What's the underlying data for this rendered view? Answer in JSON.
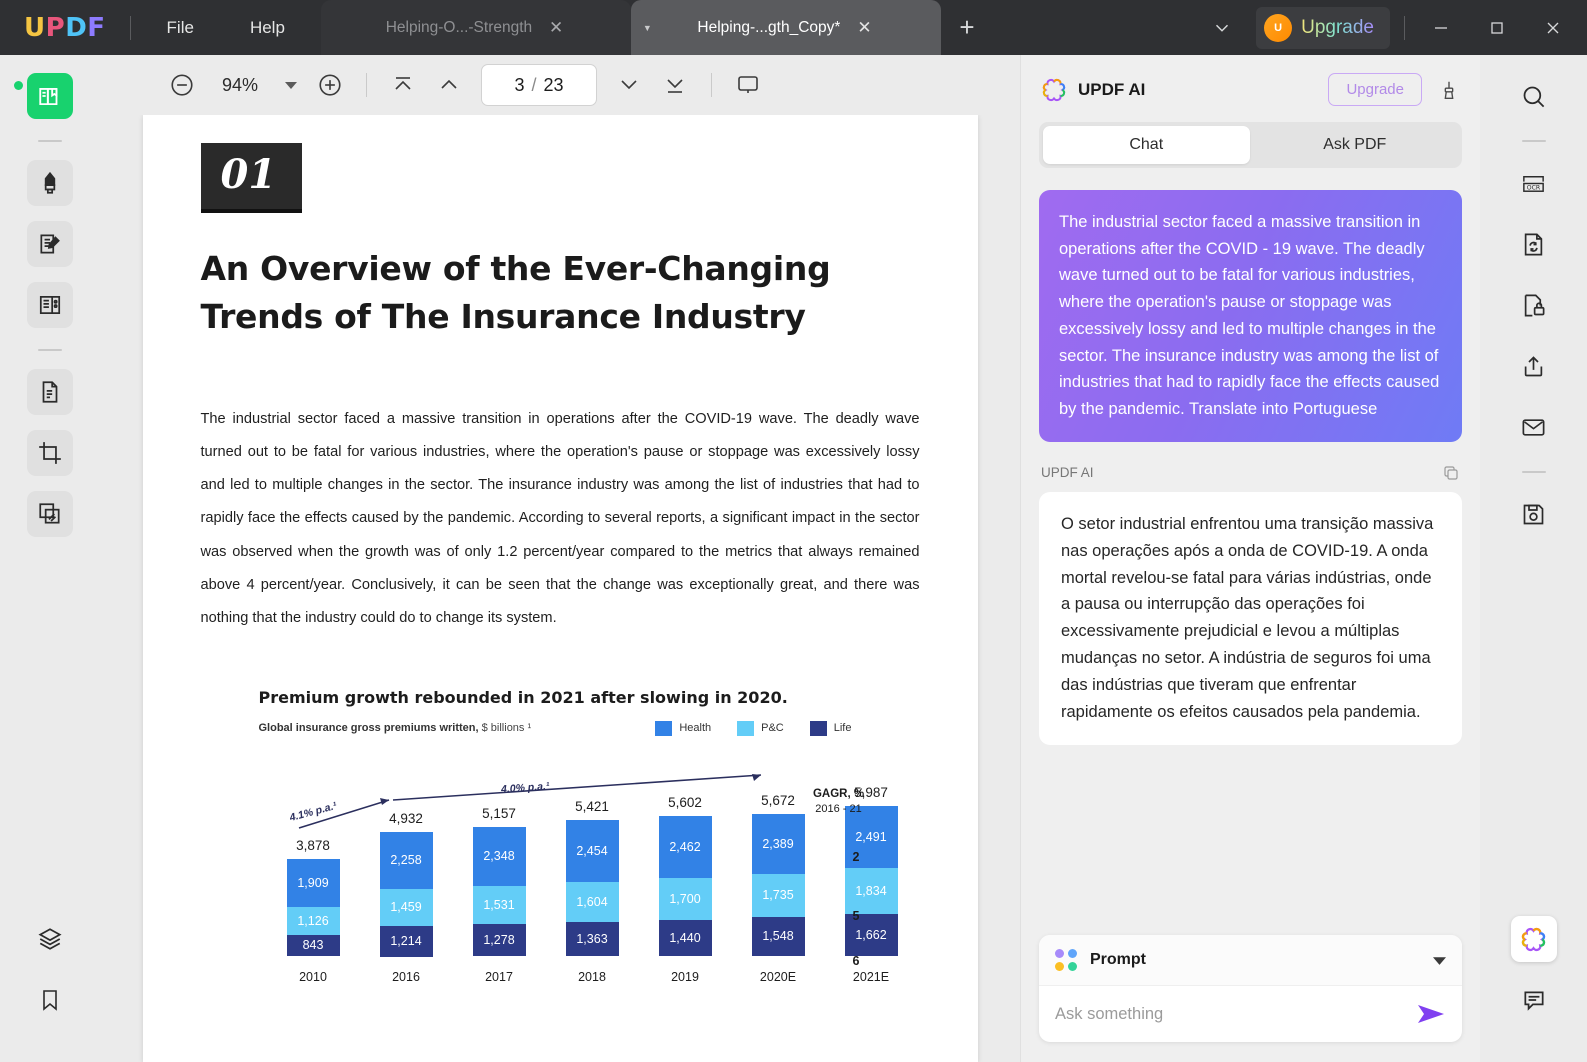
{
  "window": {
    "logo": "UPDF",
    "menus": [
      {
        "label": "File",
        "name": "menu-file"
      },
      {
        "label": "Help",
        "name": "menu-help"
      }
    ],
    "tabs": [
      {
        "label": "Helping-O...-Strength",
        "active": false
      },
      {
        "label": "Helping-...gth_Copy*",
        "active": true
      }
    ],
    "new_tab_label": "+",
    "upgrade_label": "Upgrade",
    "upgrade_badge": "U",
    "minimize_label": "Minimize",
    "maximize_label": "Maximize",
    "close_label": "Close"
  },
  "toolbar": {
    "zoom_out": "Zoom out",
    "zoom_value": "94%",
    "zoom_in": "Zoom in",
    "first_page": "First page",
    "prev_page": "Previous page",
    "current_page": "3",
    "page_separator": "/",
    "total_pages": "23",
    "next_page": "Next page",
    "last_page": "Last page",
    "presentation": "Presentation mode"
  },
  "left_rail": {
    "items": [
      {
        "name": "reader-icon",
        "label": "Reader"
      },
      {
        "name": "highlighter-icon",
        "label": "Comment"
      },
      {
        "name": "edit-pdf-icon",
        "label": "Edit PDF"
      },
      {
        "name": "page-edit-icon",
        "label": "Organize Pages"
      },
      {
        "name": "convert-icon",
        "label": "Convert PDF"
      },
      {
        "name": "crop-icon",
        "label": "Crop"
      },
      {
        "name": "batch-icon",
        "label": "Batch"
      }
    ],
    "bottom": [
      {
        "name": "layers-icon",
        "label": "Layers"
      },
      {
        "name": "bookmark-icon",
        "label": "Bookmark"
      }
    ]
  },
  "right_rail": {
    "items": [
      {
        "name": "search-icon",
        "label": "Search"
      },
      {
        "name": "ocr-icon",
        "label": "OCR"
      },
      {
        "name": "compress-icon",
        "label": "Compress"
      },
      {
        "name": "protect-icon",
        "label": "Protect"
      },
      {
        "name": "share-icon",
        "label": "Share"
      },
      {
        "name": "email-icon",
        "label": "Email"
      },
      {
        "name": "save-icon",
        "label": "Save"
      }
    ],
    "bottom": [
      {
        "name": "updf-ai-icon",
        "label": "UPDF AI"
      },
      {
        "name": "comment-icon",
        "label": "Comments"
      }
    ]
  },
  "document": {
    "chapter_number": "01",
    "title": "An Overview of the Ever-Changing Trends of The Insurance Industry",
    "paragraph": "The industrial sector faced a massive transition in operations after the COVID-19 wave. The deadly wave turned out to be fatal for various industries, where the operation's pause or stoppage was excessively lossy and led to multiple changes in the sector. The insurance industry was among the list of industries that had to rapidly face the effects caused by the pandemic. According to several reports, a significant impact in the sector was observed when the growth was of only 1.2 percent/year compared to the metrics that always remained above 4 percent/year. Conclusively, it can be seen that the change was exceptionally great, and there was nothing that the industry could do to change its system."
  },
  "chart_data": {
    "type": "bar",
    "title": "Premium growth rebounded in 2021 after slowing in 2020.",
    "subtitle_bold": "Global insurance gross premiums written,",
    "subtitle_unit": "$ billions ¹",
    "xlabel": "",
    "ylabel": "",
    "stacked": true,
    "grid": false,
    "legend_position": "top-right",
    "categories": [
      "2010",
      "2016",
      "2017",
      "2018",
      "2019",
      "2020E",
      "2021E"
    ],
    "totals": [
      3878,
      4932,
      5157,
      5421,
      5602,
      5672,
      5987
    ],
    "series": [
      {
        "name": "Health",
        "color": "#3282e6",
        "values": [
          1909,
          2258,
          2348,
          2454,
          2462,
          2389,
          2491
        ]
      },
      {
        "name": "P&C",
        "color": "#63cdf7",
        "values": [
          1126,
          1459,
          1531,
          1604,
          1700,
          1735,
          1834
        ]
      },
      {
        "name": "Life",
        "color": "#2d3b87",
        "values": [
          843,
          1214,
          1278,
          1363,
          1440,
          1548,
          1662
        ]
      }
    ],
    "annotations": [
      {
        "text": "4.1% p.a.¹",
        "kind": "growth-arrow"
      },
      {
        "text": "4.0% p.a.¹",
        "kind": "growth-arrow"
      }
    ],
    "side_table": {
      "header": "GAGR, %",
      "subheader": "2016 - 21",
      "values": [
        "2",
        "5",
        "6"
      ]
    },
    "display_labels": {
      "totals": [
        "3,878",
        "4,932",
        "5,157",
        "5,421",
        "5,602",
        "5,672",
        "5,987"
      ],
      "Health": [
        "1,909",
        "2,258",
        "2,348",
        "2,454",
        "2,462",
        "2,389",
        "2,491"
      ],
      "P&C": [
        "1,126",
        "1,459",
        "1,531",
        "1,604",
        "1,700",
        "1,735",
        "1,834"
      ],
      "Life": [
        "843",
        "1,214",
        "1,278",
        "1,363",
        "1,440",
        "1,548",
        "1,662"
      ]
    }
  },
  "ai_panel": {
    "title": "UPDF AI",
    "upgrade_label": "Upgrade",
    "tabs": [
      {
        "label": "Chat",
        "active": true
      },
      {
        "label": "Ask PDF",
        "active": false
      }
    ],
    "user_message": "The industrial sector faced a massive transition in operations after the COVID - 19 wave. The deadly wave turned out to be fatal for various industries, where the operation's pause or stoppage was excessively lossy and led to multiple changes in the sector. The insurance industry was among the list of industries that had to rapidly face the effects caused by the pandemic. Translate into Portuguese",
    "response_label": "UPDF AI",
    "response_text": "O setor industrial enfrentou uma transição massiva nas operações após a onda de COVID-19. A onda mortal revelou-se fatal para várias indústrias, onde a pausa ou interrupção das operações foi excessivamente prejudicial e levou a múltiplas mudanças no setor. A indústria de seguros foi uma das indústrias que tiveram que enfrentar rapidamente os efeitos causados pela pandemia.",
    "prompt_label": "Prompt",
    "input_placeholder": "Ask something",
    "input_value": ""
  },
  "colors": {
    "accent_green": "#18d26e",
    "accent_purple": "#8040f0",
    "titlebar": "#2f3033",
    "panel_bg": "#efefef"
  }
}
